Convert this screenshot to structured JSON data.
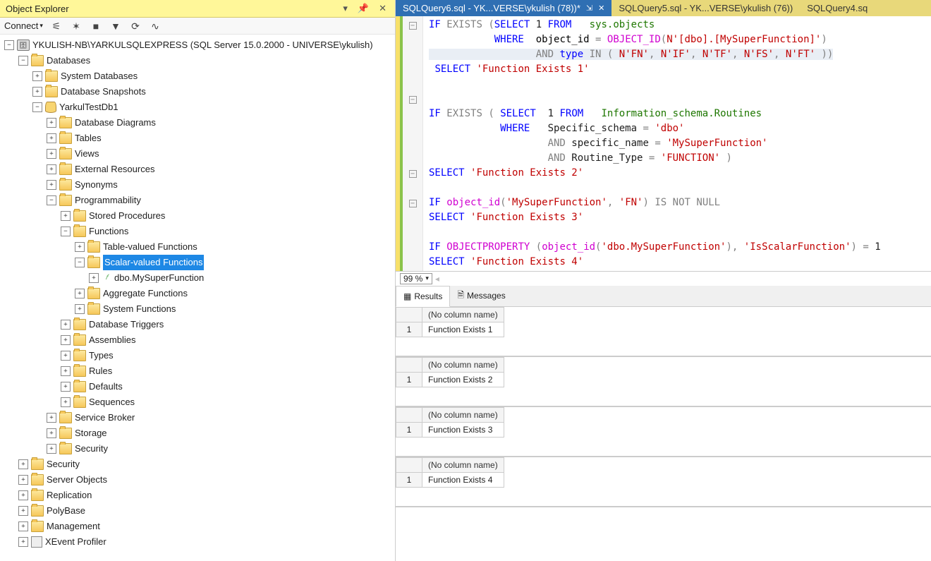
{
  "object_explorer": {
    "title": "Object Explorer",
    "connect_label": "Connect",
    "server": "YKULISH-NB\\YARKULSQLEXPRESS (SQL Server 15.0.2000 - UNIVERSE\\ykulish)",
    "databases": "Databases",
    "system_databases": "System Databases",
    "database_snapshots": "Database Snapshots",
    "db1": "YarkulTestDb1",
    "db_diagrams": "Database Diagrams",
    "tables": "Tables",
    "views": "Views",
    "external_resources": "External Resources",
    "synonyms": "Synonyms",
    "programmability": "Programmability",
    "stored_procedures": "Stored Procedures",
    "functions": "Functions",
    "tvf": "Table-valued Functions",
    "svf": "Scalar-valued Functions",
    "my_fn": "dbo.MySuperFunction",
    "agg_fn": "Aggregate Functions",
    "sys_fn": "System Functions",
    "db_triggers": "Database Triggers",
    "assemblies": "Assemblies",
    "types": "Types",
    "rules": "Rules",
    "defaults": "Defaults",
    "sequences": "Sequences",
    "service_broker": "Service Broker",
    "storage": "Storage",
    "security_inner": "Security",
    "security": "Security",
    "server_objects": "Server Objects",
    "replication": "Replication",
    "polybase": "PolyBase",
    "management": "Management",
    "xevent": "XEvent Profiler"
  },
  "tabs": {
    "t1": "SQLQuery6.sql - YK...VERSE\\ykulish (78))*",
    "t2": "SQLQuery5.sql - YK...VERSE\\ykulish (76))",
    "t3": "SQLQuery4.sq"
  },
  "zoom": "99 %",
  "results_tab": "Results",
  "messages_tab": "Messages",
  "grids": [
    {
      "header": "(No column name)",
      "row": "1",
      "value": "Function Exists 1"
    },
    {
      "header": "(No column name)",
      "row": "1",
      "value": "Function Exists 2"
    },
    {
      "header": "(No column name)",
      "row": "1",
      "value": "Function Exists 3"
    },
    {
      "header": "(No column name)",
      "row": "1",
      "value": "Function Exists 4"
    }
  ]
}
